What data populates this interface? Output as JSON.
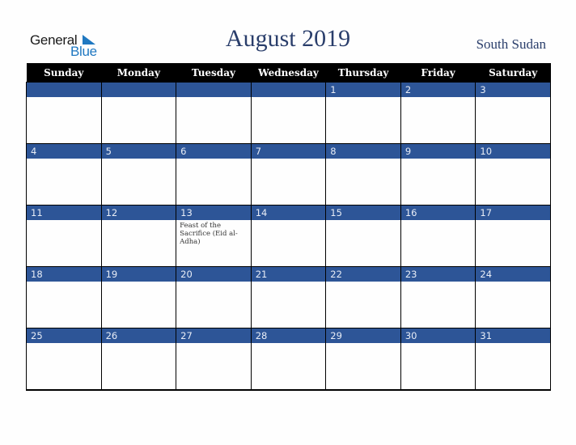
{
  "logo": {
    "line1": "General",
    "line2": "Blue"
  },
  "title": "August 2019",
  "country": "South Sudan",
  "colors": {
    "header_bg": "#000000",
    "date_band": "#2d5597",
    "title": "#2a3e6b",
    "logo_blue": "#1f78c1"
  },
  "weekdays": [
    "Sunday",
    "Monday",
    "Tuesday",
    "Wednesday",
    "Thursday",
    "Friday",
    "Saturday"
  ],
  "weeks": [
    {
      "days": [
        "",
        "",
        "",
        "",
        "1",
        "2",
        "3"
      ],
      "events": [
        "",
        "",
        "",
        "",
        "",
        "",
        ""
      ]
    },
    {
      "days": [
        "4",
        "5",
        "6",
        "7",
        "8",
        "9",
        "10"
      ],
      "events": [
        "",
        "",
        "",
        "",
        "",
        "",
        ""
      ]
    },
    {
      "days": [
        "11",
        "12",
        "13",
        "14",
        "15",
        "16",
        "17"
      ],
      "events": [
        "",
        "",
        "Feast of the Sacrifice (Eid al-Adha)",
        "",
        "",
        "",
        ""
      ]
    },
    {
      "days": [
        "18",
        "19",
        "20",
        "21",
        "22",
        "23",
        "24"
      ],
      "events": [
        "",
        "",
        "",
        "",
        "",
        "",
        ""
      ]
    },
    {
      "days": [
        "25",
        "26",
        "27",
        "28",
        "29",
        "30",
        "31"
      ],
      "events": [
        "",
        "",
        "",
        "",
        "",
        "",
        ""
      ]
    }
  ]
}
